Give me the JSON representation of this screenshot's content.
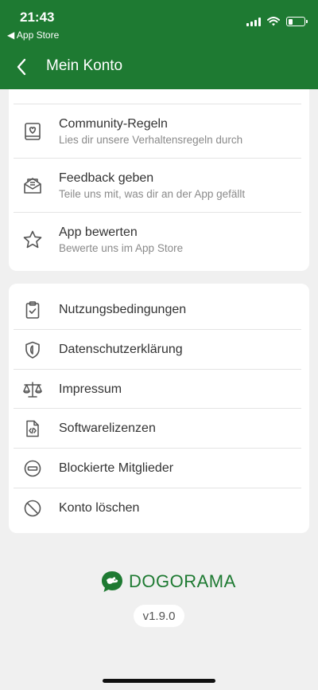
{
  "status_bar": {
    "time": "21:43",
    "back_app": "◀ App Store"
  },
  "header": {
    "title": "Mein Konto"
  },
  "section1": {
    "items": [
      {
        "title": "Community-Regeln",
        "subtitle": "Lies dir unsere Verhaltensregeln durch",
        "icon": "heart-book-icon"
      },
      {
        "title": "Feedback geben",
        "subtitle": "Teile uns mit, was dir an der App gefällt",
        "icon": "envelope-icon"
      },
      {
        "title": "App bewerten",
        "subtitle": "Bewerte uns im App Store",
        "icon": "star-icon"
      }
    ]
  },
  "section2": {
    "items": [
      {
        "title": "Nutzungsbedingungen",
        "icon": "clipboard-check-icon"
      },
      {
        "title": "Datenschutzerklärung",
        "icon": "shield-icon"
      },
      {
        "title": "Impressum",
        "icon": "scale-icon"
      },
      {
        "title": "Softwarelizenzen",
        "icon": "code-file-icon"
      },
      {
        "title": "Blockierte Mitglieder",
        "icon": "block-minus-icon"
      },
      {
        "title": "Konto löschen",
        "icon": "prohibited-icon"
      }
    ]
  },
  "footer": {
    "brand": "DOGORAMA",
    "version": "v1.9.0"
  },
  "colors": {
    "brand_green": "#1e7a32",
    "background": "#f0f0f0"
  }
}
